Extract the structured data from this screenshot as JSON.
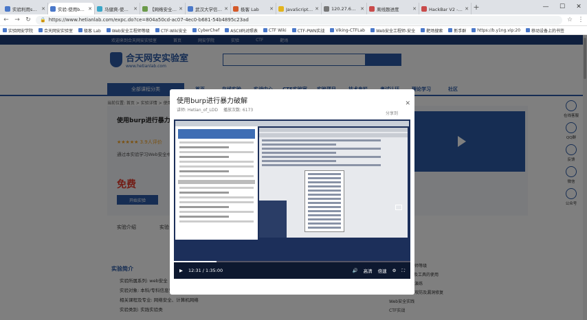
{
  "browser": {
    "tabs": [
      {
        "label": "实验利用sqlmap的",
        "color": "#4a78c9"
      },
      {
        "label": "实验:使用burp进行",
        "color": "#4a78c9",
        "active": true
      },
      {
        "label": "马健爽-使用burp进",
        "color": "#3aa7c9"
      },
      {
        "label": "【网络安全红客】",
        "color": "#6b9a4a"
      },
      {
        "label": "武汉大学信息安全",
        "color": "#4a78c9"
      },
      {
        "label": "极客 Lab",
        "color": "#d45a2a"
      },
      {
        "label": "JavaScript 混淆",
        "color": "#e3b41d"
      },
      {
        "label": "120.27.61.239:80",
        "color": "#777"
      },
      {
        "label": "离线题进度",
        "color": "#c94a4a"
      },
      {
        "label": "HackBar V2 - 下载",
        "color": "#c94a4a"
      }
    ],
    "url": "https://www.hetianlab.com/expc.do?ce=804a50cd-ac07-4ec0-b681-54b4895c23ad",
    "bookmarks": [
      "实验网安学院",
      "合天网安实验室",
      "极客 Lab",
      "Web安全工程师等级",
      "CTF-Wiki安全",
      "CyberChef",
      "ASCII码对照表",
      "CTF Wiki",
      "CTF-PWN实战",
      "Viking-CTFLab",
      "Web安全工程师-安全",
      "靶场搜索",
      "新手群",
      "https://b.y1ng.vip:20",
      "移动设备上的书签"
    ]
  },
  "site": {
    "topstrip": [
      "欢迎来到合天网安实验室",
      "首页",
      "网安学院",
      "实验",
      "CTF",
      "靶场"
    ],
    "logo_title": "合天网安实验室",
    "logo_sub": "www.hetianlab.com",
    "nav_category": "全部课程分类",
    "nav": [
      "首页",
      "在线实验",
      "实战中心",
      "CTF实验室",
      "实验项目",
      "技术专栏",
      "考试认证",
      "理论学习",
      "社区"
    ],
    "breadcrumb": "当前位置: 首页 > 实验详情 > 使用burp进行暴力破解",
    "course_title": "使用burp进行暴力破解",
    "stars": "★★★★★ 3.9人评价",
    "desc": "通过本实验学习Web安全中暴力破解的方法和Burp Suite使用技巧",
    "price": "免费",
    "start_label": "开始实验",
    "tabs": [
      "实验介绍",
      "实验目录",
      "学习路径",
      "相关推荐"
    ],
    "section_title": "实验简介",
    "section_items": [
      "实验所属系列: web安全",
      "实验对象: 本科/专科信息安全专业",
      "相关课程及专业: 网络安全、计算机网络",
      "实验类别: 实践实验类"
    ],
    "right_col": [
      "Web安全工程师等级",
      "暴力破解原理及工具的使用",
      "Web安全实战演练",
      "全面了解Web攻防及漏洞修复",
      "Web安全实践",
      "CTF实战"
    ],
    "rail": [
      "在线客服",
      "QQ群",
      "反馈",
      "微信",
      "公众号"
    ]
  },
  "modal": {
    "title": "使用burp进行暴力破解",
    "author": "讲师: Hetian_of_LDD",
    "date": "播放次数: 6173",
    "share": "分享到",
    "close": "✕",
    "time": "12:31 / 1:35:00",
    "quality": "高清",
    "speed": "倍速"
  }
}
